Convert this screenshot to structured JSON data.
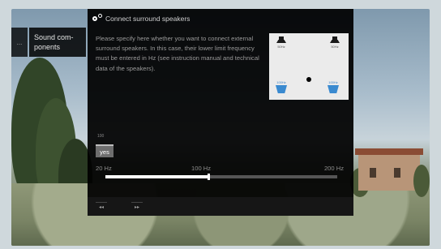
{
  "side_menu": {
    "prev_label": "...",
    "item_label_line1": "Sound com-",
    "item_label_line2": "ponents"
  },
  "dialog": {
    "title": "Connect surround speakers",
    "title_icon": "settings-icon",
    "description": "Please specify here whether you want to connect external surround speakers. In this case, their lower limit frequency must be entered in Hz (see instruction manual and technical data of the speakers).",
    "diagram": {
      "top_left_label": "50Hz",
      "top_right_label": "50Hz",
      "bottom_left_label": "100Hz",
      "bottom_right_label": "100Hz",
      "front_speaker_color": "#1a1a1a",
      "surround_speaker_color": "#3a8ad0"
    },
    "value_top": "100",
    "selected_option": "yes",
    "ticks": [
      "20 Hz",
      "100 Hz",
      "200 Hz"
    ],
    "slider": {
      "min_hz": 20,
      "max_hz": 200,
      "value_hz": 100
    },
    "footer": {
      "prev_icon": "rewind-icon",
      "prev_glyph": "◂◂",
      "next_icon": "fast-forward-icon",
      "next_glyph": "▸▸"
    }
  }
}
